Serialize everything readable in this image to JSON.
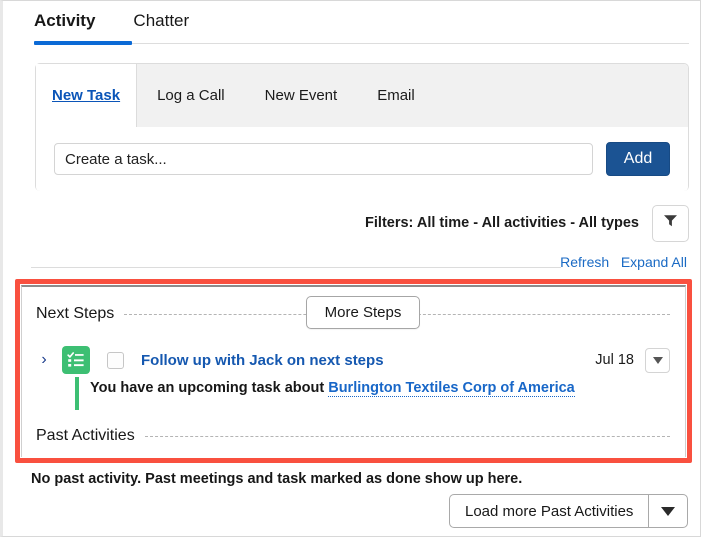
{
  "top_tabs": [
    {
      "label": "Activity",
      "active": true
    },
    {
      "label": "Chatter",
      "active": false
    }
  ],
  "composer": {
    "tabs": [
      {
        "label": "New Task",
        "active": true
      },
      {
        "label": "Log a Call",
        "active": false
      },
      {
        "label": "New Event",
        "active": false
      },
      {
        "label": "Email",
        "active": false
      }
    ],
    "input_placeholder": "Create a task...",
    "input_value": "",
    "add_label": "Add"
  },
  "filters": {
    "text": "Filters: All time - All activities - All types",
    "funnel_icon": "funnel-icon"
  },
  "links": {
    "refresh": "Refresh",
    "expand_all": "Expand All"
  },
  "next_steps": {
    "title": "Next Steps",
    "more_steps_label": "More Steps",
    "task": {
      "expand_icon": "chevron-right-icon",
      "type_icon": "task-checklist-icon",
      "checkbox_checked": false,
      "title": "Follow up with Jack on next steps",
      "date": "Jul 18",
      "menu_icon": "caret-down-icon",
      "description_prefix": "You have an upcoming task about",
      "description_link": "Burlington Textiles Corp of America"
    }
  },
  "past_activities": {
    "title": "Past Activities",
    "empty_text": "No past activity. Past meetings and task marked as done show up here.",
    "load_more_label": "Load more Past Activities",
    "load_more_caret_icon": "caret-down-icon"
  },
  "colors": {
    "accent_blue": "#0b6ad6",
    "link_blue": "#1558b0",
    "add_button_blue": "#1b5393",
    "task_green": "#3dbf73",
    "highlight_red": "#f9503f"
  }
}
